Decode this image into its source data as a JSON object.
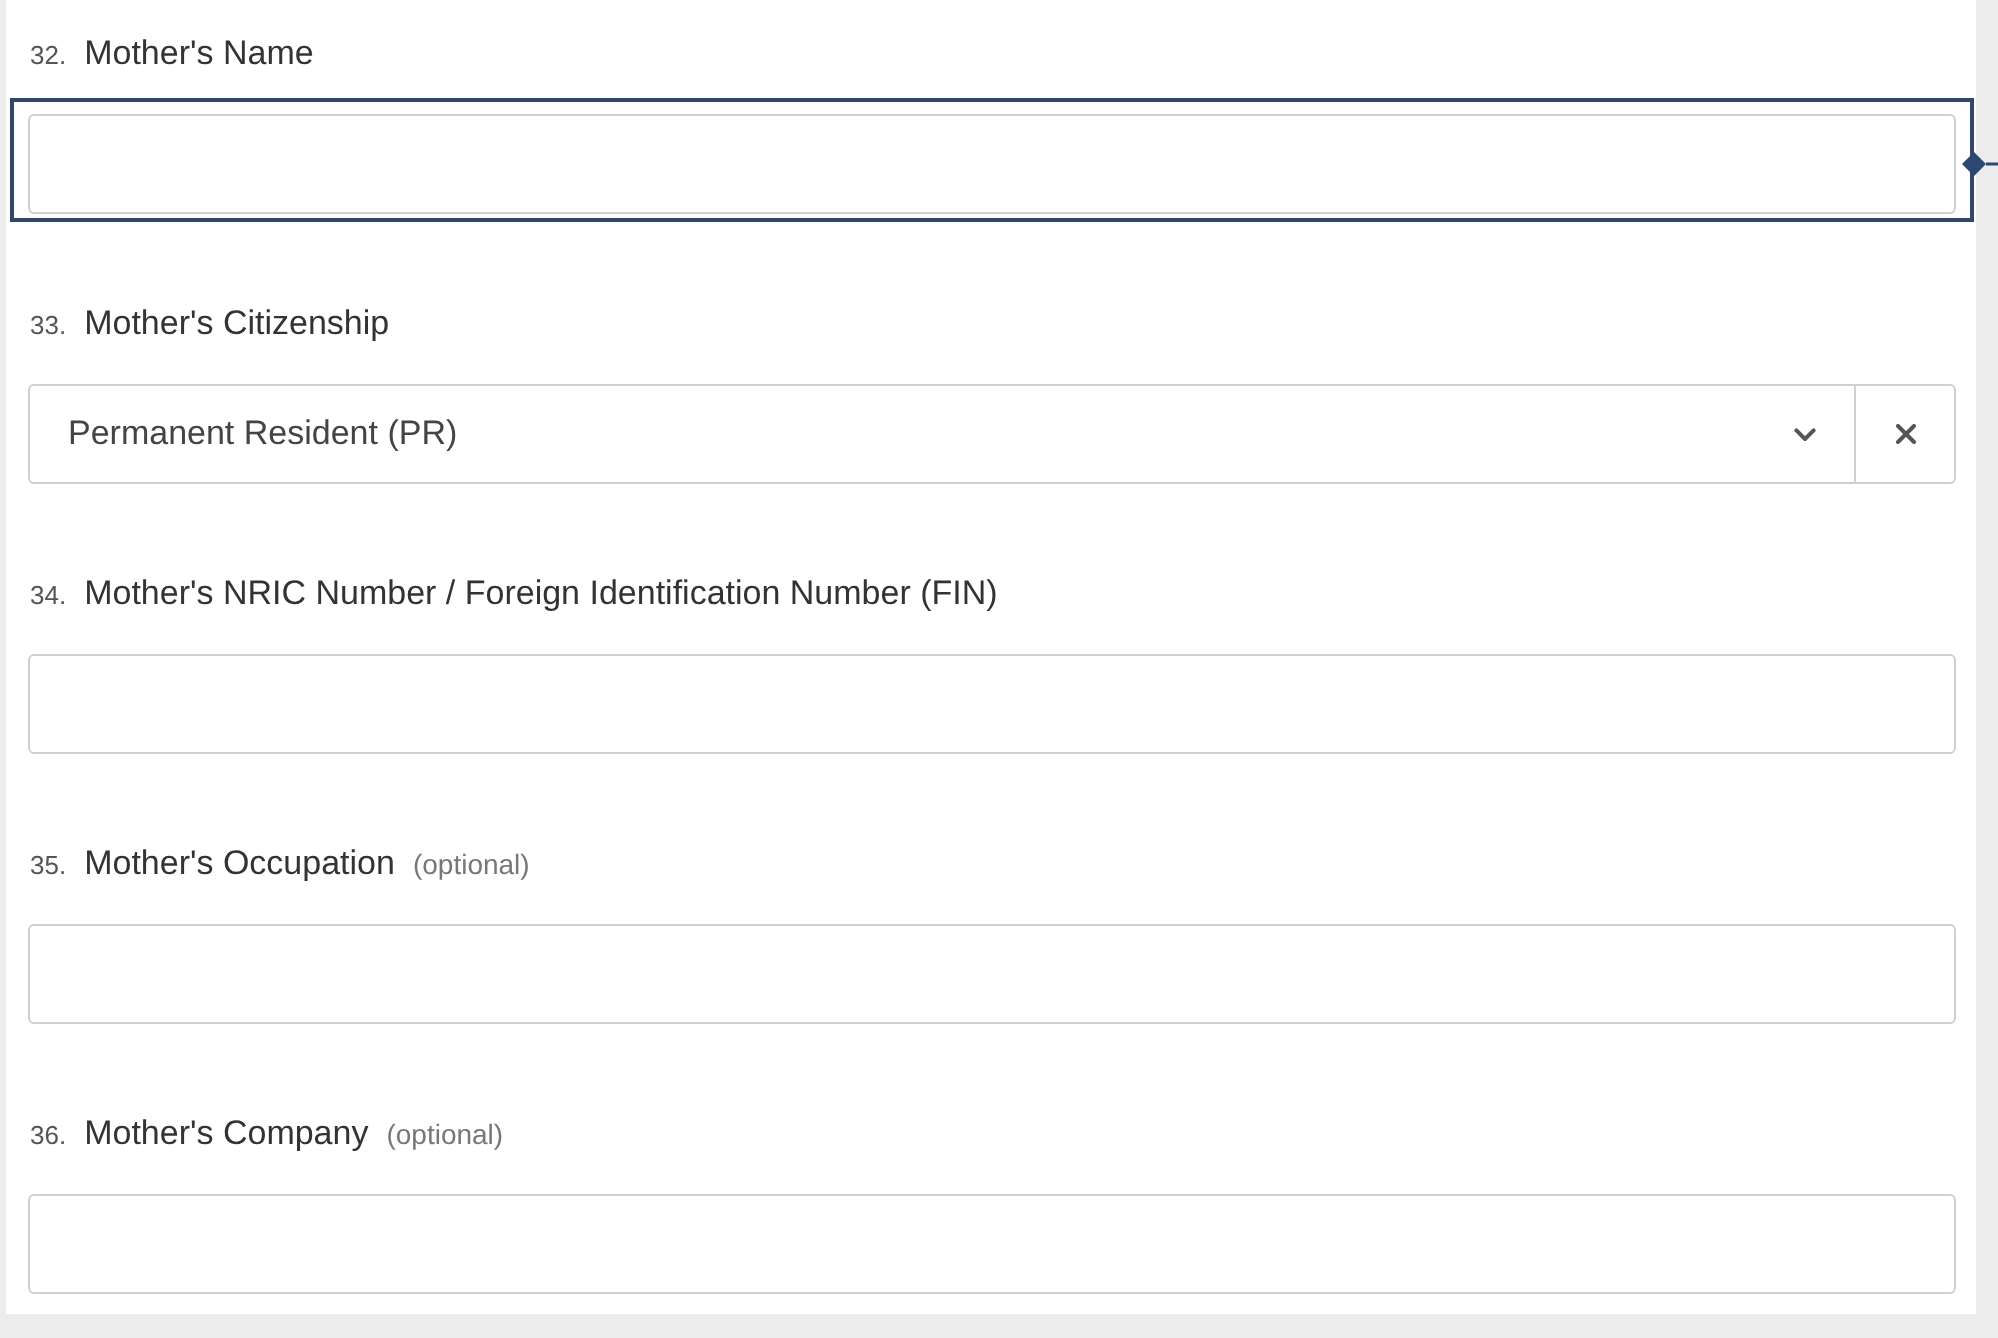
{
  "questions": [
    {
      "number": "32.",
      "label": "Mother's Name",
      "kind": "text",
      "focused": true
    },
    {
      "number": "33.",
      "label": "Mother's Citizenship",
      "kind": "select",
      "value": "Permanent Resident (PR)",
      "focused": false
    },
    {
      "number": "34.",
      "label": "Mother's NRIC Number / Foreign Identification Number (FIN)",
      "kind": "text",
      "focused": false
    },
    {
      "number": "35.",
      "label": "Mother's Occupation",
      "note": "(optional)",
      "kind": "text",
      "focused": false
    },
    {
      "number": "36.",
      "label": "Mother's Company",
      "note": "(optional)",
      "kind": "text",
      "focused": false
    }
  ]
}
